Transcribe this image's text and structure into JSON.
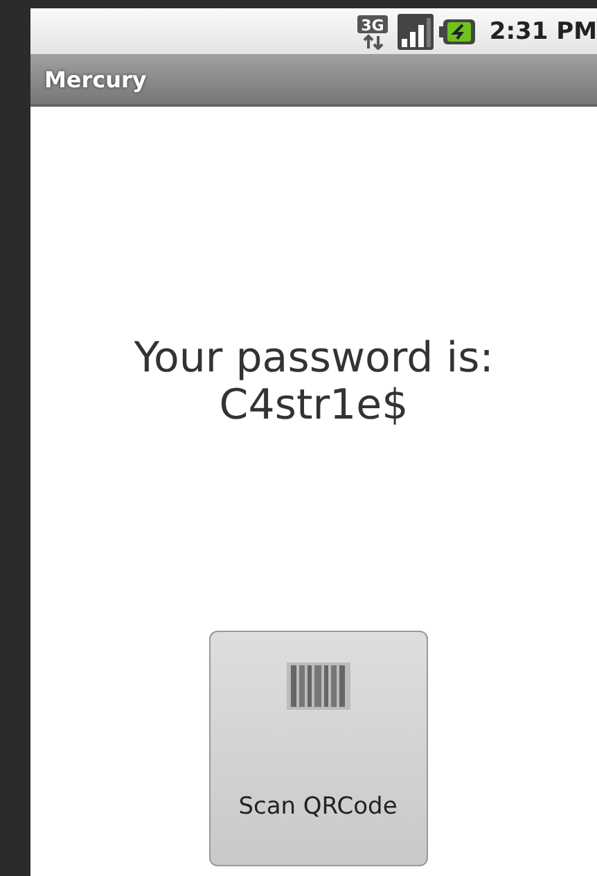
{
  "status_bar": {
    "network_type": "3G",
    "time": "2:31 PM"
  },
  "title_bar": {
    "title": "Mercury"
  },
  "message": {
    "label": "Your password is:",
    "password": "C4str1e$"
  },
  "scan_button": {
    "label": "Scan QRCode"
  }
}
